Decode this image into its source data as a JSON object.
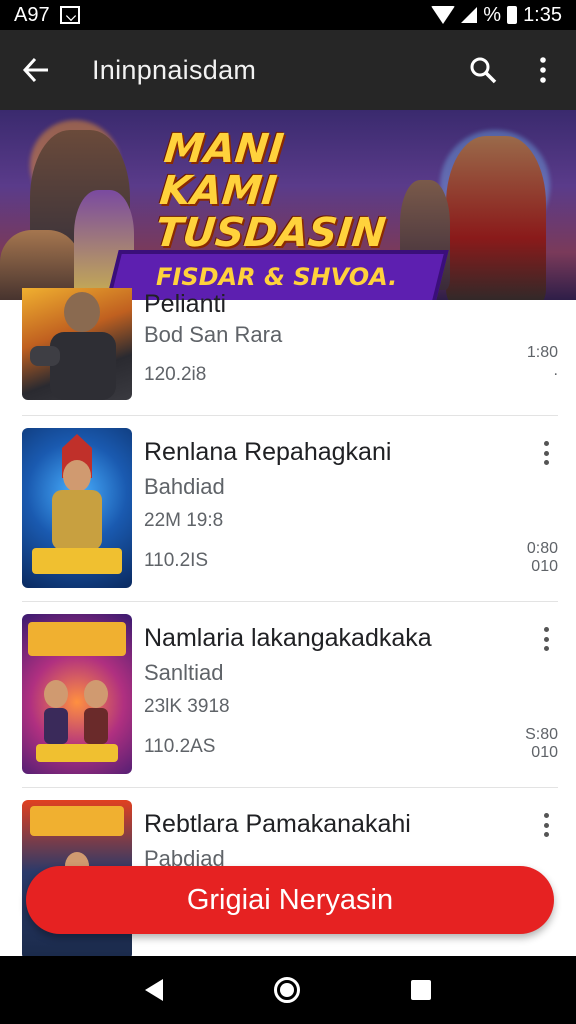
{
  "status_bar": {
    "left_text": "A97",
    "battery_percent": "%",
    "time": "1:35"
  },
  "app_bar": {
    "title": "Ininpnaisdam"
  },
  "banner": {
    "headline_line1": "MANI KAMI",
    "headline_line2": "TUSDASIN",
    "ribbon": "FISDAR & SHVOA."
  },
  "items": [
    {
      "name": "Pelianti",
      "subtitle": "Bod San Rara",
      "meta": "",
      "date": "120.2i8",
      "time_line1": "1:80",
      "time_line2": "."
    },
    {
      "name": "Renlana Repahagkani",
      "subtitle": "Bahdiad",
      "meta": "22M 19:8",
      "date": "110.2IS",
      "time_line1": "0:80",
      "time_line2": "010"
    },
    {
      "name": "Namlaria lakangakadkaka",
      "subtitle": "Sanltiad",
      "meta": "23lK 3918",
      "date": "110.2AS",
      "time_line1": "S:80",
      "time_line2": "010"
    },
    {
      "name": "Rebtlara Pamakanakahi",
      "subtitle": "Pabdiad",
      "meta": "",
      "date": "",
      "time_line1": "",
      "time_line2": ""
    }
  ],
  "fab": {
    "label": "Grigiai Neryasin"
  },
  "colors": {
    "app_bar": "#262626",
    "accent": "#e62222",
    "banner_text": "#ffd23c"
  }
}
